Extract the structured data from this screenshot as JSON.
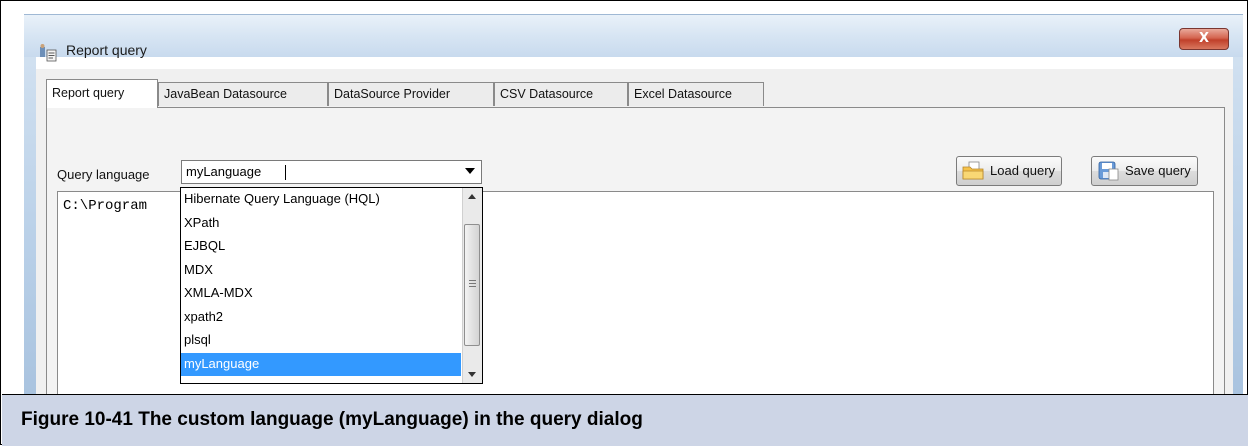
{
  "window": {
    "title": "Report query",
    "close_glyph": "X"
  },
  "tabs": [
    {
      "label": "Report query",
      "active": true
    },
    {
      "label": "JavaBean Datasource",
      "active": false
    },
    {
      "label": "DataSource Provider",
      "active": false
    },
    {
      "label": "CSV Datasource",
      "active": false
    },
    {
      "label": "Excel Datasource",
      "active": false
    }
  ],
  "query_language": {
    "label": "Query language",
    "value": "myLanguage",
    "options": [
      "Hibernate Query Language (HQL)",
      "XPath",
      "EJBQL",
      "MDX",
      "XMLA-MDX",
      "xpath2",
      "plsql",
      "myLanguage"
    ],
    "selected_index": 7
  },
  "toolbar": {
    "load_label": "Load query",
    "save_label": "Save query"
  },
  "editor": {
    "text": "C:\\Program"
  },
  "caption": {
    "text": "Figure 10-41  The custom language (myLanguage) in the query dialog"
  },
  "colors": {
    "selection": "#3399ff",
    "caption_bg": "#cdd5e6",
    "close_button": "#c0402a"
  },
  "icons": {
    "app": "report-query-app-icon",
    "load": "folder-open-icon",
    "save": "save-disk-icon",
    "combo": "chevron-down-icon",
    "close": "close-icon"
  }
}
